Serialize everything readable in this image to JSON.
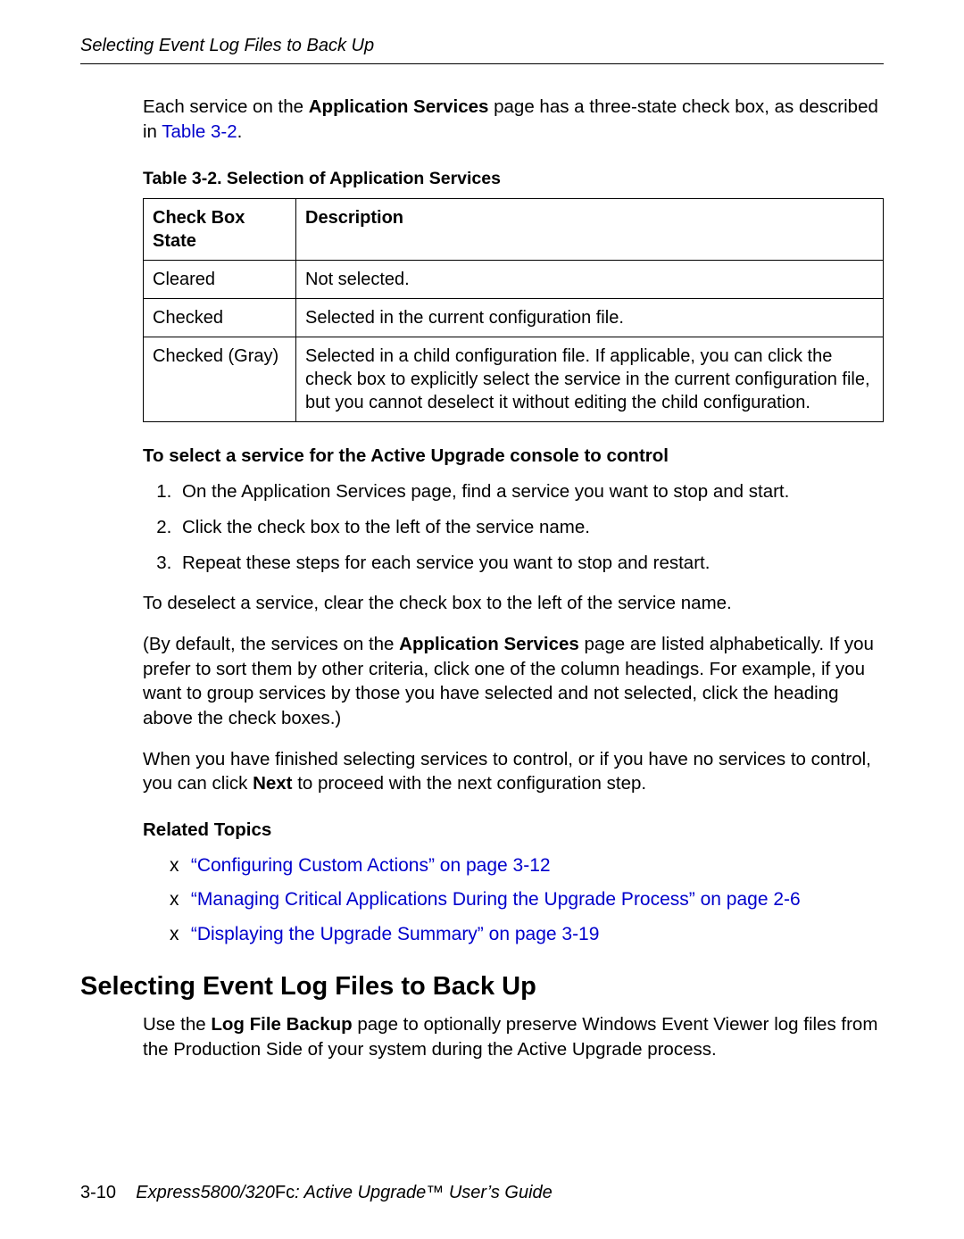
{
  "header": {
    "running_title": "Selecting Event Log Files to Back Up"
  },
  "intro": {
    "pre": "Each service on the ",
    "bold1": "Application Services",
    "mid": " page has a three-state check box, as described in ",
    "link": "Table 3-2",
    "post": "."
  },
  "table": {
    "caption": "Table 3-2. Selection of Application Services",
    "headers": [
      "Check Box State",
      "Description"
    ],
    "rows": [
      [
        "Cleared",
        "Not selected."
      ],
      [
        "Checked",
        "Selected in the current configuration file."
      ],
      [
        "Checked (Gray)",
        "Selected in a child configuration file. If applicable, you can click the check box to explicitly select the service in the current configuration file, but you cannot deselect it without editing the child configuration."
      ]
    ]
  },
  "procedure": {
    "title": "To select a service for the Active Upgrade console to control",
    "steps": {
      "s1_pre": "On the ",
      "s1_bold": "Application Services",
      "s1_post": " page, find a service you want to stop and start.",
      "s2": "Click the check box to the left of the service name.",
      "s3": "Repeat these steps for each service you want to stop and restart."
    }
  },
  "after": {
    "deselect": "To deselect a service, clear the check box to the left of the service name.",
    "sort_pre": "(By default, the services on the ",
    "sort_bold": "Application Services",
    "sort_post": " page are listed alphabetically. If you prefer to sort them by other criteria, click one of the column headings. For example, if you want to group services by those you have selected and not selected, click the heading above the check boxes.)",
    "next_pre": "When you have finished selecting services to control, or if you have no services to control, you can click ",
    "next_bold": "Next",
    "next_post": " to proceed with the next configuration step."
  },
  "related": {
    "title": "Related Topics",
    "bullet": "x",
    "items": [
      "“Configuring Custom Actions” on page 3-12",
      "“Managing Critical Applications During the Upgrade Process” on page 2-6",
      "“Displaying the Upgrade Summary” on page 3-19"
    ]
  },
  "section": {
    "heading": "Selecting Event Log Files to Back Up",
    "para_pre": "Use the ",
    "para_bold": "Log File Backup",
    "para_post": " page to optionally preserve Windows Event Viewer log files from the Production Side of your system during the Active Upgrade process."
  },
  "footer": {
    "page": "3-10",
    "title_italic": "Express5800/320",
    "title_roman": "Fc",
    "title_italic2": ": Active Upgrade™ User’s Guide"
  }
}
